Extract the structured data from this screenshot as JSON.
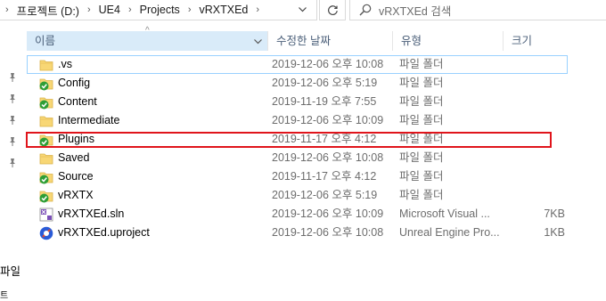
{
  "breadcrumb": {
    "items": [
      "프로젝트 (D:)",
      "UE4",
      "Projects",
      "vRXTXEd"
    ],
    "leading_separator": "›",
    "separator": "›"
  },
  "search": {
    "placeholder": "vRXTXEd 검색"
  },
  "navpane": {
    "file_label": "파일",
    "bottom_label": "트"
  },
  "columns": {
    "name": "이름",
    "date": "수정한 날짜",
    "type": "유형",
    "size": "크기"
  },
  "files": [
    {
      "name": ".vs",
      "date": "2019-12-06 오후 10:08",
      "type": "파일 폴더",
      "size": "",
      "icon": "folder-icon"
    },
    {
      "name": "Config",
      "date": "2019-12-06 오후 5:19",
      "type": "파일 폴더",
      "size": "",
      "icon": "synced-folder-icon"
    },
    {
      "name": "Content",
      "date": "2019-11-19 오후 7:55",
      "type": "파일 폴더",
      "size": "",
      "icon": "synced-folder-icon"
    },
    {
      "name": "Intermediate",
      "date": "2019-12-06 오후 10:09",
      "type": "파일 폴더",
      "size": "",
      "icon": "folder-icon"
    },
    {
      "name": "Plugins",
      "date": "2019-11-17 오후 4:12",
      "type": "파일 폴더",
      "size": "",
      "icon": "synced-folder-icon"
    },
    {
      "name": "Saved",
      "date": "2019-12-06 오후 10:08",
      "type": "파일 폴더",
      "size": "",
      "icon": "folder-icon"
    },
    {
      "name": "Source",
      "date": "2019-11-17 오후 4:12",
      "type": "파일 폴더",
      "size": "",
      "icon": "synced-folder-icon"
    },
    {
      "name": "vRXTX",
      "date": "2019-12-06 오후 5:19",
      "type": "파일 폴더",
      "size": "",
      "icon": "synced-folder-icon"
    },
    {
      "name": "vRXTXEd.sln",
      "date": "2019-12-06 오후 10:09",
      "type": "Microsoft Visual ...",
      "size": "7KB",
      "icon": "visual-studio-solution-icon"
    },
    {
      "name": "vRXTXEd.uproject",
      "date": "2019-12-06 오후 10:08",
      "type": "Unreal Engine Pro...",
      "size": "1KB",
      "icon": "unreal-project-icon"
    }
  ],
  "colors": {
    "header_hover": "#d9ebf9",
    "highlight_box": "#e0141b",
    "folder": "#f8d775",
    "sync_check": "#2e9e36"
  }
}
